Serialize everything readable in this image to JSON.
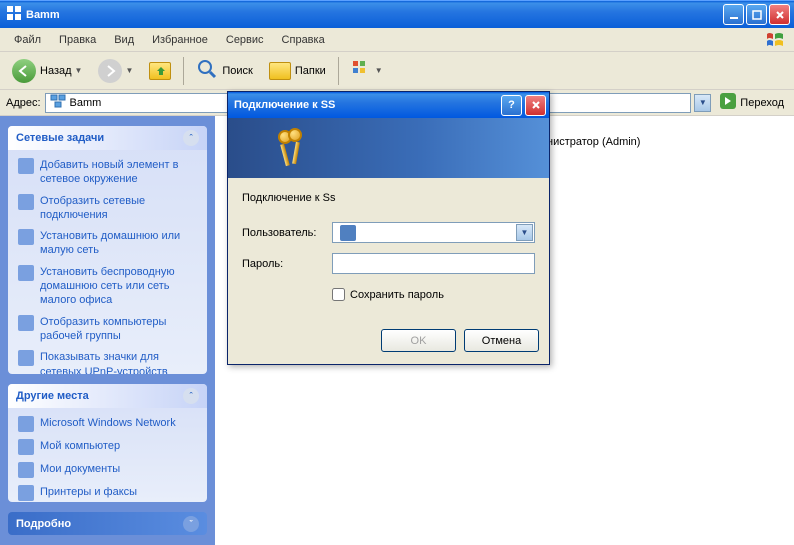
{
  "window": {
    "title": "Bamm"
  },
  "menu": [
    "Файл",
    "Правка",
    "Вид",
    "Избранное",
    "Сервис",
    "Справка"
  ],
  "toolbar": {
    "back": "Назад",
    "search": "Поиск",
    "folders": "Папки"
  },
  "address": {
    "label": "Адрес:",
    "value": "Bamm",
    "go": "Переход"
  },
  "sidebar": {
    "group1": {
      "title": "Сетевые задачи",
      "items": [
        "Добавить новый элемент в сетевое окружение",
        "Отобразить сетевые подключения",
        "Установить домашнюю или малую сеть",
        "Установить беспроводную домашнюю сеть или сеть малого офиса",
        "Отобразить компьютеры рабочей группы",
        "Показывать значки для сетевых UPnP-устройств"
      ]
    },
    "group2": {
      "title": "Другие места",
      "items": [
        "Microsoft Windows Network",
        "Мой компьютер",
        "Мои документы",
        "Принтеры и факсы"
      ]
    },
    "group3": {
      "title": "Подробно"
    }
  },
  "main": {
    "admin_suffix": "нистратор (Admin)"
  },
  "dialog": {
    "title": "Подключение к SS",
    "subtitle": "Подключение к Ss",
    "user_label": "Пользователь:",
    "pass_label": "Пароль:",
    "user_value": "",
    "save_pw": "Сохранить пароль",
    "ok": "OK",
    "cancel": "Отмена"
  }
}
